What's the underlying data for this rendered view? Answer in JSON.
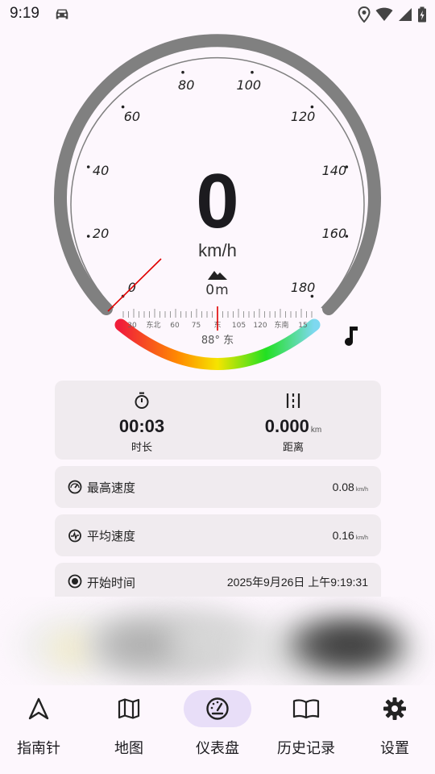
{
  "status_bar": {
    "time": "9:19",
    "icons": [
      "car-icon",
      "location-icon",
      "wifi-icon",
      "signal-icon",
      "battery-charging-icon"
    ]
  },
  "gauge": {
    "ticks": [
      "0",
      "20",
      "40",
      "60",
      "80",
      "100",
      "120",
      "140",
      "160",
      "180"
    ],
    "speed": "0",
    "unit": "km/h",
    "altitude": "0m",
    "compass_labels": [
      "30",
      "东北",
      "60",
      "75",
      "东",
      "105",
      "120",
      "东南",
      "15"
    ],
    "heading": "88° 东",
    "colors": {
      "ring": "#808080",
      "needle": "#e00000"
    }
  },
  "stats": {
    "duration_value": "00:03",
    "duration_label": "时长",
    "distance_value": "0.000",
    "distance_unit": "km",
    "distance_label": "距离"
  },
  "rows": {
    "max_speed_label": "最高速度",
    "max_speed_value": "0.08",
    "max_speed_unit": "km/h",
    "avg_speed_label": "平均速度",
    "avg_speed_value": "0.16",
    "avg_speed_unit": "km/h",
    "start_time_label": "开始时间",
    "start_time_value": "2025年9月26日 上午9:19:31"
  },
  "nav": {
    "items": [
      {
        "label": "指南针",
        "icon": "navigation-arrow-icon"
      },
      {
        "label": "地图",
        "icon": "map-icon"
      },
      {
        "label": "仪表盘",
        "icon": "speedometer-icon"
      },
      {
        "label": "历史记录",
        "icon": "book-icon"
      },
      {
        "label": "设置",
        "icon": "gear-icon"
      }
    ],
    "active_index": 2,
    "active_color": "#e8def8"
  }
}
